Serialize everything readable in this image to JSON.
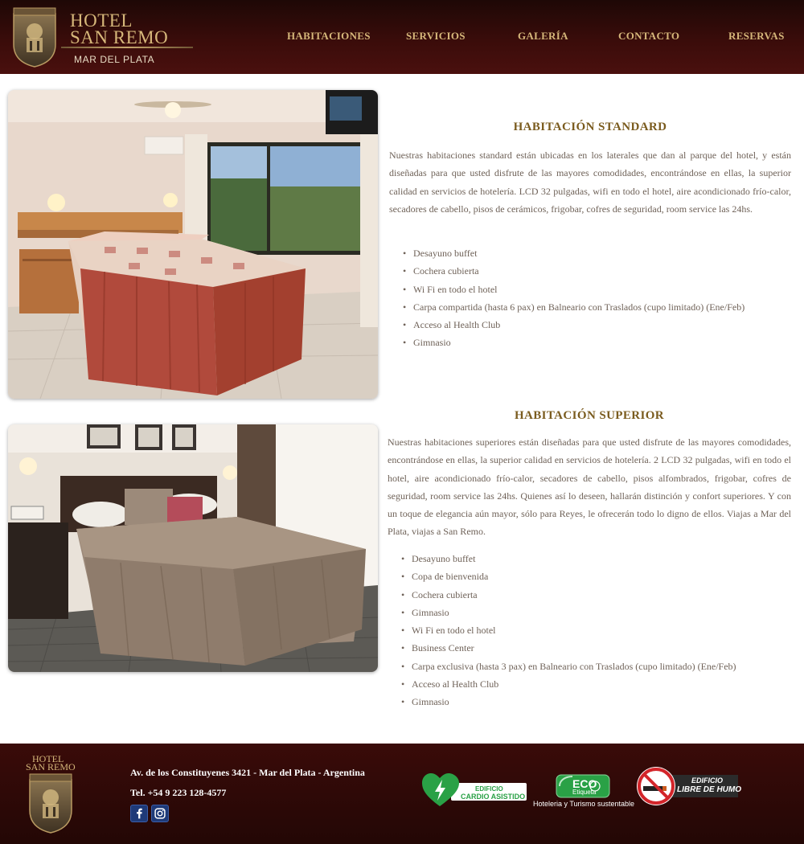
{
  "brand": {
    "name_line1": "HOTEL",
    "name_line2": "SAN REMO",
    "city": "MAR DEL PLATA"
  },
  "nav": [
    {
      "label": "HABITACIONES"
    },
    {
      "label": "SERVICIOS"
    },
    {
      "label": "GALERÍA"
    },
    {
      "label": "CONTACTO"
    },
    {
      "label": "RESERVAS"
    }
  ],
  "rooms": [
    {
      "title": "HABITACIÓN STANDARD",
      "description": "Nuestras habitaciones standard están ubicadas en los laterales que dan al parque del hotel, y están diseñadas para que usted disfrute de las mayores comodidades, encontrándose en ellas, la superior calidad en servicios de hotelería. LCD 32 pulgadas, wifi en todo el hotel, aire acondicionado frío-calor, secadores de cabello, pisos de cerámicos, frigobar, cofres de seguridad, room service las 24hs.",
      "amenities": [
        "Desayuno buffet",
        "Cochera cubierta",
        "Wi Fi en todo el hotel",
        "Carpa compartida (hasta 6 pax) en Balneario con Traslados (cupo limitado) (Ene/Feb)",
        "Acceso al Health Club",
        "Gimnasio"
      ]
    },
    {
      "title": "HABITACIÓN SUPERIOR",
      "description": "Nuestras habitaciones superiores están diseñadas para que usted disfrute de las mayores comodidades, encontrándose en ellas, la superior calidad en servicios de hotelería. 2 LCD 32 pulgadas, wifi en todo el hotel, aire acondicionado frío-calor, secadores de cabello, pisos alfombrados, frigobar, cofres de seguridad, room service las 24hs. Quienes así lo deseen, hallarán distinción y confort superiores. Y con un toque de elegancia aún mayor, sólo para Reyes, le ofrecerán todo lo digno de ellos. Viajas a Mar del Plata, viajas a San Remo.",
      "amenities": [
        "Desayuno buffet",
        "Copa de bienvenida",
        "Cochera cubierta",
        "Gimnasio",
        "Wi Fi en todo el hotel",
        "Business Center",
        "Carpa exclusiva (hasta 3 pax) en Balneario con Traslados (cupo limitado) (Ene/Feb)",
        "Acceso al Health Club",
        "Gimnasio"
      ]
    }
  ],
  "footer": {
    "brand_line1": "HOTEL",
    "brand_line2": "SAN REMO",
    "address": "Av. de los Constituyenes 3421 - Mar del Plata - Argentina",
    "phone": "Tel. +54 9 223 128-4577",
    "social": [
      {
        "icon": "facebook-icon"
      },
      {
        "icon": "instagram-icon"
      }
    ],
    "badges": {
      "cardio_line1": "EDIFICIO",
      "cardio_line2": "CARDIO ASISTIDO",
      "eco_word": "ECO",
      "eco_sub_word": "Etiqueta",
      "eco_caption": "Hoteleria y Turismo sustentable",
      "smoke_line1": "EDIFICIO",
      "smoke_line2": "LIBRE DE HUMO"
    }
  },
  "colors": {
    "header_bg": "#3a0c0a",
    "gold": "#d6b77a",
    "title_gold": "#7a5b1e",
    "body_text": "#6f6258"
  }
}
